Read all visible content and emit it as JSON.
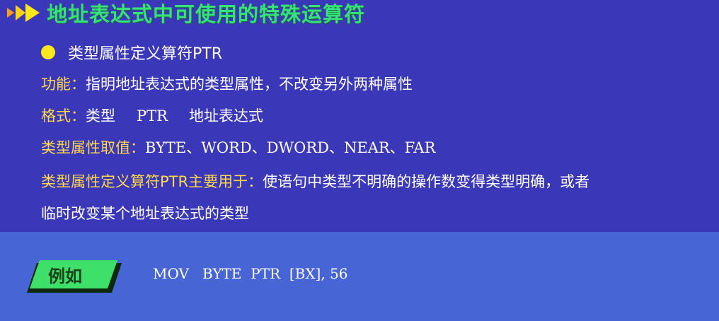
{
  "title": "地址表达式中可使用的特殊运算符",
  "bullet": "类型属性定义算符PTR",
  "function_line": {
    "label": "功能：",
    "text": "指明地址表达式的类型属性，不改变另外两种属性"
  },
  "format_line": {
    "label": "格式：",
    "part1": "类型",
    "part2": "PTR",
    "part3": "地址表达式"
  },
  "values_line": {
    "label": "类型属性取值：",
    "text": "BYTE、WORD、DWORD、NEAR、FAR"
  },
  "usage_line": {
    "label": "类型属性定义算符PTR主要用于：",
    "text": "使语句中类型不明确的操作数变得类型明确，或者",
    "continuation": "临时改变某个地址表达式的类型"
  },
  "example": {
    "badge": "例如",
    "code": "MOV   BYTE  PTR  [BX], 56"
  },
  "colors": {
    "background_top": "#3a37b8",
    "background_bottom": "#4865d6",
    "title": "#37e07a",
    "label": "#ffd84a",
    "bullet": "#ffe81a",
    "badge": "#3fe06a"
  }
}
